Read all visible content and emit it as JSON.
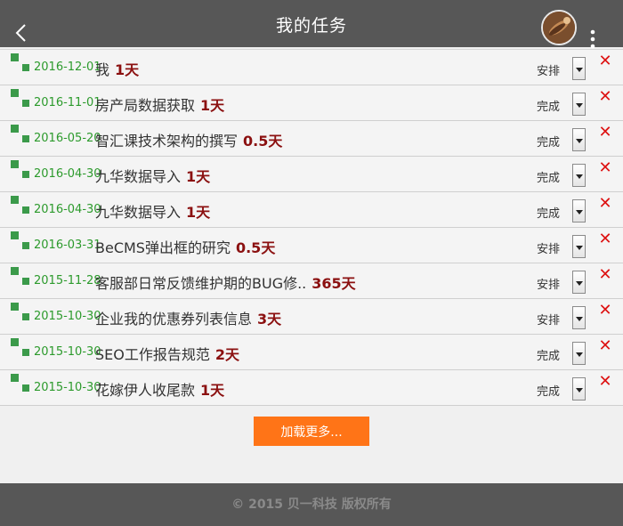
{
  "header": {
    "title": "我的任务",
    "back_icon": "chevron-left-icon",
    "more_icon": "more-vertical-icon"
  },
  "tasks": [
    {
      "date": "2016-12-01",
      "name": "我",
      "duration": "1天",
      "status": "安排"
    },
    {
      "date": "2016-11-01",
      "name": "房产局数据获取",
      "duration": "1天",
      "status": "完成"
    },
    {
      "date": "2016-05-20",
      "name": "智汇课技术架构的撰写",
      "duration": "0.5天",
      "status": "完成"
    },
    {
      "date": "2016-04-30",
      "name": "九华数据导入",
      "duration": "1天",
      "status": "完成"
    },
    {
      "date": "2016-04-30",
      "name": "九华数据导入",
      "duration": "1天",
      "status": "完成"
    },
    {
      "date": "2016-03-31",
      "name": "BeCMS弹出框的研究",
      "duration": "0.5天",
      "status": "安排"
    },
    {
      "date": "2015-11-28",
      "name": "客服部日常反馈维护期的BUG修..",
      "duration": "365天",
      "status": "安排"
    },
    {
      "date": "2015-10-30",
      "name": "企业我的优惠券列表信息",
      "duration": "3天",
      "status": "安排"
    },
    {
      "date": "2015-10-30",
      "name": "SEO工作报告规范",
      "duration": "2天",
      "status": "完成"
    },
    {
      "date": "2015-10-30",
      "name": "花嫁伊人收尾款",
      "duration": "1天",
      "status": "完成"
    }
  ],
  "load_more_label": "加载更多...",
  "footer_text": "© 2015 贝一科技 版权所有",
  "colors": {
    "header_bg": "#575757",
    "date_green": "#2c9a2c",
    "duration_red": "#8b1010",
    "delete_red": "#dd1111",
    "button_orange": "#ff7417"
  }
}
